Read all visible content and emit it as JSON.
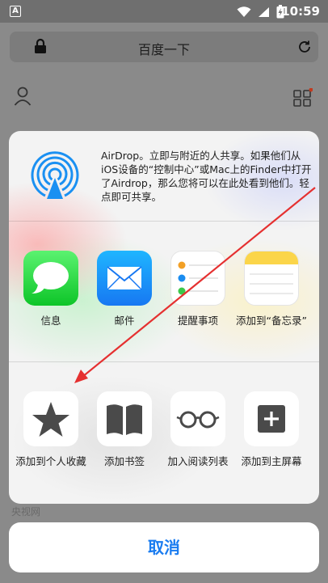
{
  "status_bar": {
    "notif_glyph": "A",
    "time": "10:59",
    "icons": [
      "wifi-icon",
      "signal-icon",
      "battery-charging-icon"
    ]
  },
  "browser": {
    "title": "百度一下",
    "bottom_label": "央视网"
  },
  "airdrop": {
    "text": "AirDrop。立即与附近的人共享。如果他们从iOS设备的“控制中心”或Mac上的Finder中打开了Airdrop，那么您将可以在此处看到他们。轻点即可共享。"
  },
  "share_apps": [
    {
      "label": "信息",
      "icon": "messages-icon"
    },
    {
      "label": "邮件",
      "icon": "mail-icon"
    },
    {
      "label": "提醒事项",
      "icon": "reminders-icon"
    },
    {
      "label": "添加到“备忘录”",
      "icon": "notes-icon"
    }
  ],
  "share_actions": [
    {
      "label": "添加到个人收藏",
      "icon": "star-icon"
    },
    {
      "label": "添加书签",
      "icon": "book-icon"
    },
    {
      "label": "加入阅读列表",
      "icon": "glasses-icon"
    },
    {
      "label": "添加到主屏幕",
      "icon": "plus-square-icon"
    }
  ],
  "cancel_label": "取消",
  "colors": {
    "accent": "#1a7cf0",
    "arrow": "#e53030"
  }
}
